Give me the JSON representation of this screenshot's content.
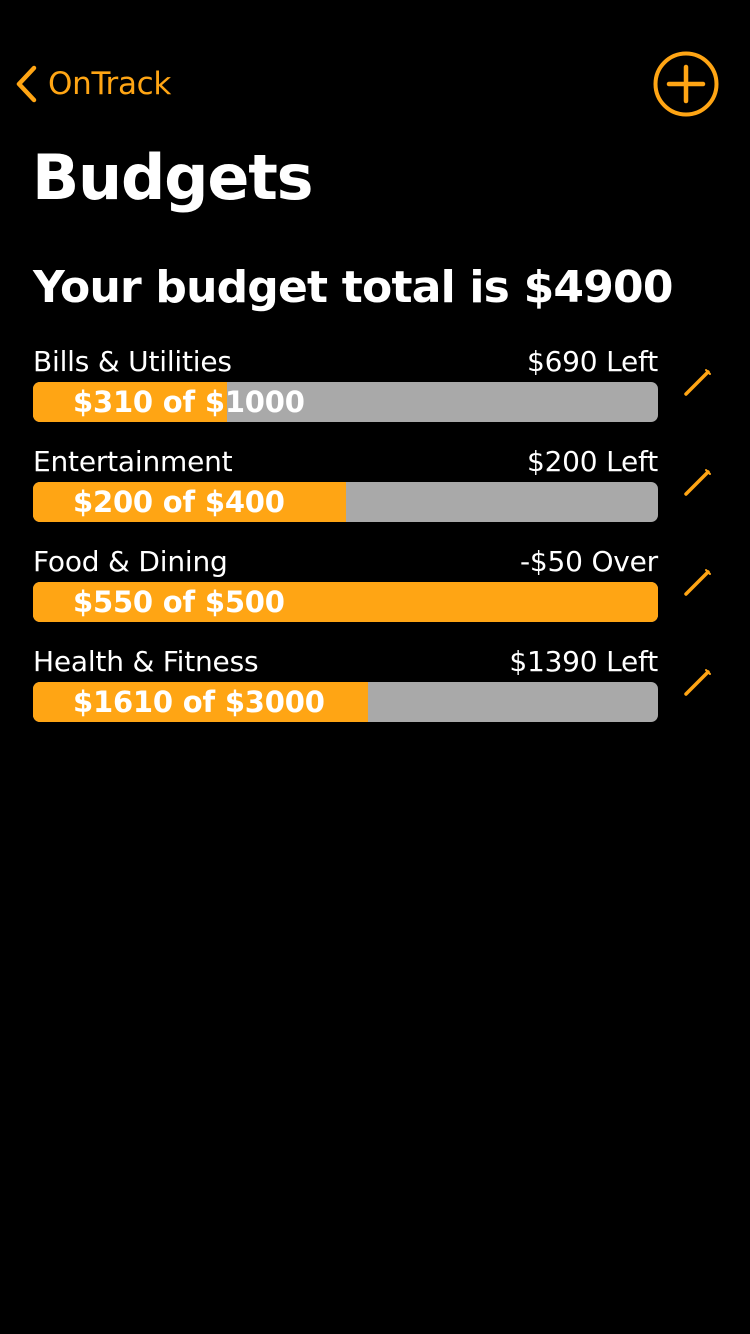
{
  "theme": {
    "accent": "#FFA514",
    "track": "#A9A9A9",
    "background": "#000000",
    "text": "#FFFFFF"
  },
  "nav": {
    "back_label": "OnTrack",
    "back_icon": "chevron-left-icon",
    "add_icon": "plus-circle-icon"
  },
  "page": {
    "title": "Budgets",
    "total_text": "Your budget total is $4900"
  },
  "budgets": [
    {
      "name": "Bills & Utilities",
      "status": "$690 Left",
      "progress_label": "$310 of $1000",
      "spent": 310,
      "limit": 1000,
      "edit_icon": "pencil-icon"
    },
    {
      "name": "Entertainment",
      "status": "$200 Left",
      "progress_label": "$200 of $400",
      "spent": 200,
      "limit": 400,
      "edit_icon": "pencil-icon"
    },
    {
      "name": "Food & Dining",
      "status": "-$50 Over",
      "progress_label": "$550 of $500",
      "spent": 550,
      "limit": 500,
      "edit_icon": "pencil-icon"
    },
    {
      "name": "Health & Fitness",
      "status": "$1390 Left",
      "progress_label": "$1610 of $3000",
      "spent": 1610,
      "limit": 3000,
      "edit_icon": "pencil-icon"
    }
  ]
}
